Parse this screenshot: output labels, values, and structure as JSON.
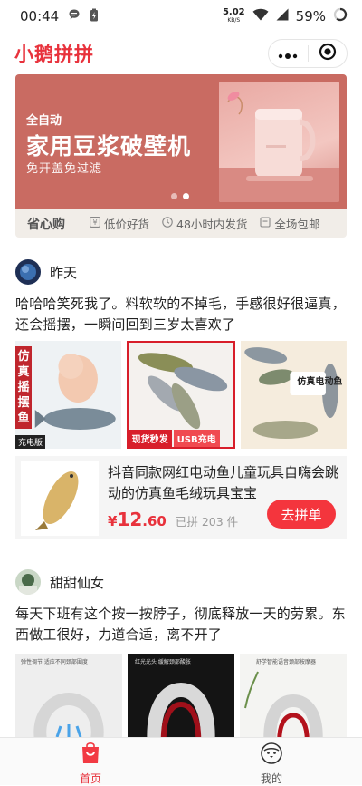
{
  "status_bar": {
    "time": "00:44",
    "net_speed_value": "5.02",
    "net_speed_unit": "KB/S",
    "battery": "59%"
  },
  "header": {
    "title": "小鹅拼拼"
  },
  "banner": {
    "subtitle": "全自动",
    "title": "家用豆浆破壁机",
    "description": "免开盖免过滤",
    "slide_count": 2,
    "active_slide": 2
  },
  "perks": {
    "main": "省心购",
    "items": [
      {
        "label": "低价好货",
        "icon": "price-tag-icon"
      },
      {
        "label": "48小时内发货",
        "icon": "clock-icon"
      },
      {
        "label": "全场包邮",
        "icon": "box-icon"
      }
    ]
  },
  "posts": [
    {
      "username": "昨天",
      "text": "哈哈哈笑死我了。料软软的不掉毛，手感很好很逼真，还会摇摆，一瞬间回到三岁太喜欢了",
      "images": [
        {
          "caption_vertical": "仿真摇摆鱼",
          "caption_tag": "充电版"
        },
        {
          "caption_left": "现货秒发",
          "caption_right": "USB充电"
        },
        {
          "caption_title": "仿真电动鱼"
        }
      ],
      "product": {
        "name": "抖音同款网红电动鱼儿童玩具自嗨会跳动的仿真鱼毛绒玩具宝宝",
        "price_symbol": "¥",
        "price_int": "12",
        "price_dec": ".60",
        "joined": "已拼 203 件",
        "button": "去拼单"
      }
    },
    {
      "username": "甜甜仙女",
      "text": "每天下班有这个按一按脖子，彻底释放一天的劳累。东西做工很好，力道合适，离不开了",
      "images": [
        {
          "caption": "弹性调节 适应不同颈部围度"
        },
        {
          "caption": "红光光头 缓解颈部酸胀"
        },
        {
          "caption": "舒学智能语音颈部按摩器"
        }
      ]
    }
  ],
  "tabbar": {
    "tabs": [
      {
        "label": "首页",
        "active": true
      },
      {
        "label": "我的",
        "active": false
      }
    ]
  },
  "colors": {
    "brand": "#e8323c",
    "banner_bg": "#c96b62",
    "perks_bg": "#f1ede8"
  }
}
